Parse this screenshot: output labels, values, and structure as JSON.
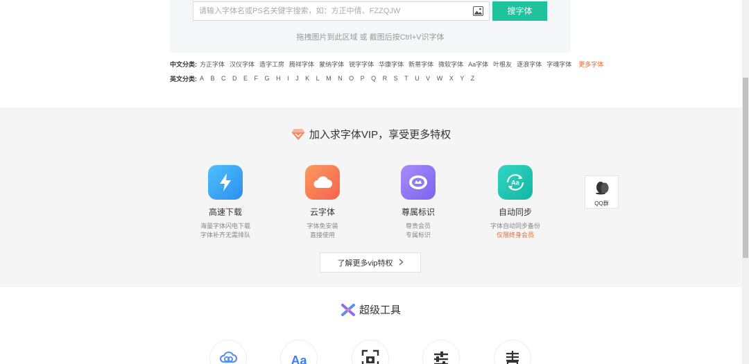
{
  "search": {
    "placeholder": "请输入字体名或PS名关键字搜索，如：方正中倩、FZZQJW",
    "button_label": "搜字体",
    "drop_hint": "拖拽图片到此区域 或 截图后按Ctrl+V识字体"
  },
  "categories": {
    "cn_label": "中文分类:",
    "cn_items": [
      "方正字体",
      "汉仪字体",
      "造字工房",
      "腾祥字体",
      "蒙纳字体",
      "锐字字体",
      "华康字体",
      "新蒂字体",
      "微软字体",
      "Aa字体",
      "叶根友",
      "逐浪字体",
      "字魂字体"
    ],
    "cn_more": "更多字体",
    "en_label": "英文分类:",
    "en_items": [
      "A",
      "B",
      "C",
      "D",
      "E",
      "F",
      "G",
      "H",
      "I",
      "J",
      "K",
      "L",
      "M",
      "N",
      "O",
      "P",
      "Q",
      "R",
      "S",
      "T",
      "U",
      "V",
      "W",
      "X",
      "Y",
      "Z"
    ]
  },
  "vip": {
    "title": "加入求字体VIP，享受更多特权",
    "features": [
      {
        "name": "高速下载",
        "desc1": "海量字体闪电下载",
        "desc2": "字体补齐无需排队",
        "icon": "lightning-icon",
        "color": "#3aa4f5"
      },
      {
        "name": "云字体",
        "desc1": "字体免安装",
        "desc2": "直接使用",
        "icon": "cloud-icon",
        "color": "#f77a52"
      },
      {
        "name": "尊属标识",
        "desc1": "尊贵会员",
        "desc2": "专属标识",
        "icon": "badge-icon",
        "color": "#8e7cf0"
      },
      {
        "name": "自动同步",
        "desc1": "字体自动同步备份",
        "desc2": "仅限终身会员",
        "icon": "sync-icon",
        "color": "#23c9b5"
      }
    ],
    "more_button": "了解更多vip特权"
  },
  "qq": {
    "label": "QQ群"
  },
  "tools": {
    "title": "超级工具"
  },
  "colors": {
    "accent": "#1ec29c",
    "orange": "#f26a2b"
  }
}
